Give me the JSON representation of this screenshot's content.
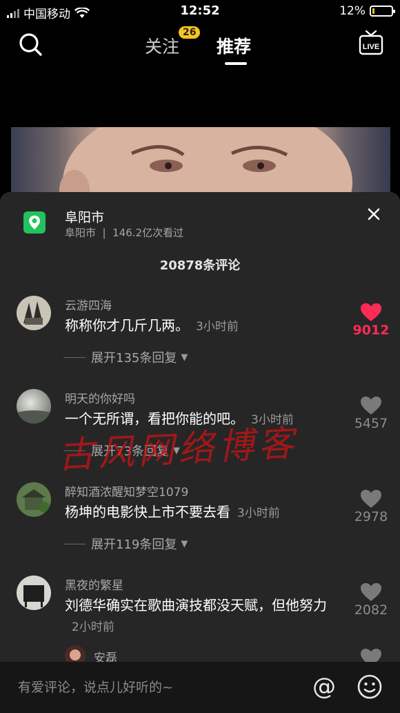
{
  "status_bar": {
    "carrier": "中国移动",
    "time": "12:52",
    "battery": "12%",
    "battery_level": 0.12
  },
  "nav": {
    "follow_label": "关注",
    "follow_badge": "26",
    "recommend_label": "推荐",
    "live_icon": "live-icon",
    "live_label": "LIVE"
  },
  "location": {
    "title": "阜阳市",
    "subtitle": "阜阳市  |  146.2亿次看过"
  },
  "comment_count": "20878条评论",
  "comments": [
    {
      "user": "云游四海",
      "text": "称称你才几斤几两。",
      "time": "3小时前",
      "replies": "展开135条回复",
      "likes": "9012",
      "liked": true
    },
    {
      "user": "明天的你好吗",
      "text": "一个无所谓，看把你能的吧。",
      "time": "3小时前",
      "replies": "展开73条回复",
      "likes": "5457",
      "liked": false
    },
    {
      "user": "醉知酒浓醒知梦空1079",
      "text": "杨坤的电影快上市不要去看",
      "time": "3小时前",
      "replies": "展开119条回复",
      "likes": "2978",
      "liked": false
    },
    {
      "user": "黑夜的繁星",
      "text": "刘德华确实在歌曲演技都没天赋，但他努力",
      "time": "2小时前",
      "replies": "",
      "likes": "2082",
      "liked": false
    },
    {
      "user": "安磊",
      "text": "",
      "time": "",
      "replies": "",
      "likes": "",
      "liked": false
    }
  ],
  "watermark": "古风网络博客",
  "input": {
    "placeholder": "有爱评论，说点儿好听的~"
  },
  "colors": {
    "like_active": "#fe2c55",
    "badge": "#f7c31c",
    "location_icon": "#22c35e",
    "sheet_bg": "#262627"
  }
}
